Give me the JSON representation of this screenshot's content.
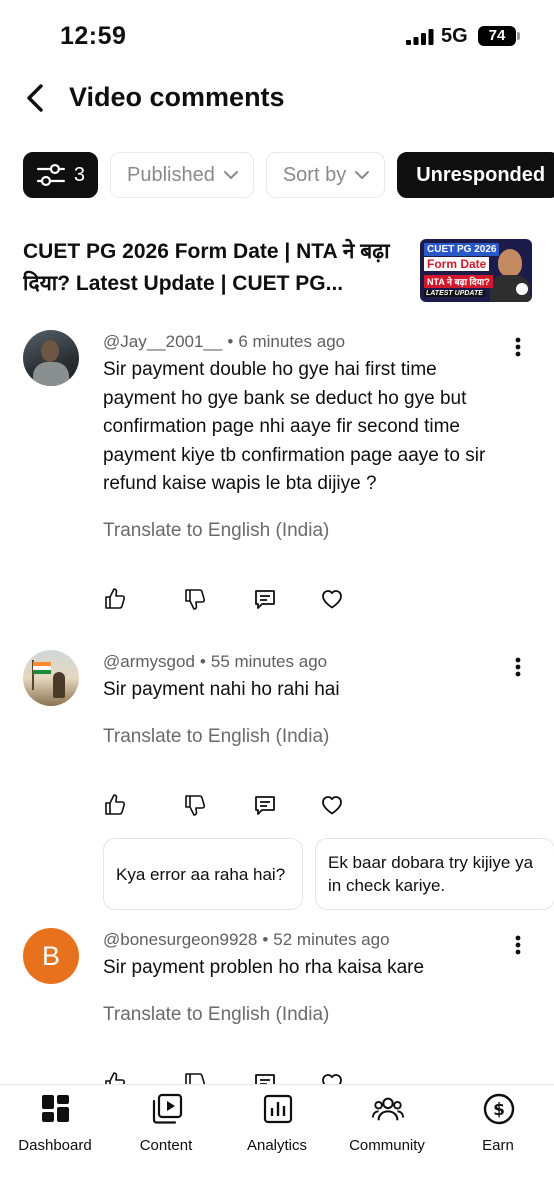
{
  "status_bar": {
    "time": "12:59",
    "network": "5G",
    "battery": "74"
  },
  "header": {
    "title": "Video comments"
  },
  "filters": {
    "count": "3",
    "chips": [
      {
        "label": "Published"
      },
      {
        "label": "Sort by"
      },
      {
        "label": "Unresponded"
      }
    ]
  },
  "video": {
    "title": "CUET PG 2026 Form Date | NTA ने बढ़ा दिया? Latest Update | CUET PG...",
    "thumbnail": {
      "line1": "CUET PG 2026",
      "line2": "Form Date",
      "line3": "NTA ने बढ़ा दिया?",
      "line4": "LATEST UPDATE"
    }
  },
  "comments": [
    {
      "author": "@Jay__2001__",
      "time": "6 minutes ago",
      "text": "Sir payment double ho gye hai first time payment ho gye bank se deduct ho gye but confirmation page nhi aaye fir second time payment kiye tb confirmation page aaye to sir refund kaise wapis le bta dijiye ?",
      "translate": "Translate to English (India)"
    },
    {
      "author": "@armysgod",
      "time": "55 minutes ago",
      "text": "Sir payment nahi ho rahi hai",
      "translate": "Translate to English (India)",
      "suggested_replies": [
        "Kya error aa raha hai?",
        "Ek baar dobara try kijiye ya in check kariye."
      ]
    },
    {
      "author": "@bonesurgeon9928",
      "avatar_letter": "B",
      "time": "52 minutes ago",
      "text": "Sir payment problen ho rha kaisa kare",
      "translate": "Translate to English (India)"
    }
  ],
  "bottom_nav": [
    {
      "label": "Dashboard",
      "icon": "dashboard-icon"
    },
    {
      "label": "Content",
      "icon": "content-icon"
    },
    {
      "label": "Analytics",
      "icon": "analytics-icon"
    },
    {
      "label": "Community",
      "icon": "community-icon"
    },
    {
      "label": "Earn",
      "icon": "earn-icon"
    }
  ],
  "colors": {
    "accent_dark": "#0f0f0f",
    "avatar_b": "#e8711e",
    "meta_text": "#606060"
  }
}
